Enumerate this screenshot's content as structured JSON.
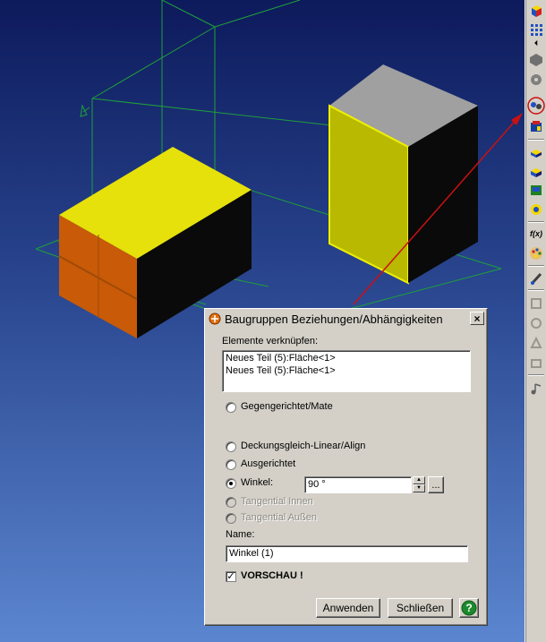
{
  "dialog": {
    "title": "Baugruppen Beziehungen/Abhängigkeiten",
    "close_label": "×",
    "elements_label": "Elemente verknüpfen:",
    "elements": [
      "Neues Teil (5):Fläche<1>",
      "Neues Teil (5):Fläche<1>"
    ],
    "options": [
      {
        "label": "Gegengerichtet/Mate",
        "selected": false,
        "enabled": true
      },
      {
        "label": "Deckungsgleich-Linear/Align",
        "selected": false,
        "enabled": true
      },
      {
        "label": "Ausgerichtet",
        "selected": false,
        "enabled": true
      },
      {
        "label": "Winkel:",
        "selected": true,
        "enabled": true
      },
      {
        "label": "Tangential Innen",
        "selected": false,
        "enabled": false
      },
      {
        "label": "Tangential Außen",
        "selected": false,
        "enabled": false
      }
    ],
    "angle_value": "90 °",
    "ellipsis_label": "...",
    "name_label": "Name:",
    "name_value": "Winkel (1)",
    "preview_label": "VORSCHAU !",
    "preview_checked": true,
    "preview_mark": "✓",
    "apply_label": "Anwenden",
    "close_button_label": "Schließen",
    "help_label": "?"
  },
  "toolbar": {
    "fx_label": "f(x)",
    "icons": [
      "view-cube-icon",
      "grid-icon",
      "hexagon-icon",
      "gear-part-icon",
      "constraint-icon",
      "assembly-icon",
      "insert-part-icon",
      "move-part-icon",
      "mate-part-icon",
      "rotate-part-icon",
      "function-icon",
      "color-palette-icon",
      "brush-icon",
      "disabled-tool-icon",
      "disabled-tool-icon",
      "disabled-tool-icon",
      "disabled-tool-icon",
      "music-note-icon"
    ]
  },
  "colors": {
    "viewport_top": "#0d1a5c",
    "viewport_bottom": "#5b86cf",
    "yellow_face": "#e6e10a",
    "orange_face": "#c85a08",
    "grey_face": "#a0a0a0",
    "wireframe": "#1fa03a",
    "pointer_line": "#cc1010"
  }
}
